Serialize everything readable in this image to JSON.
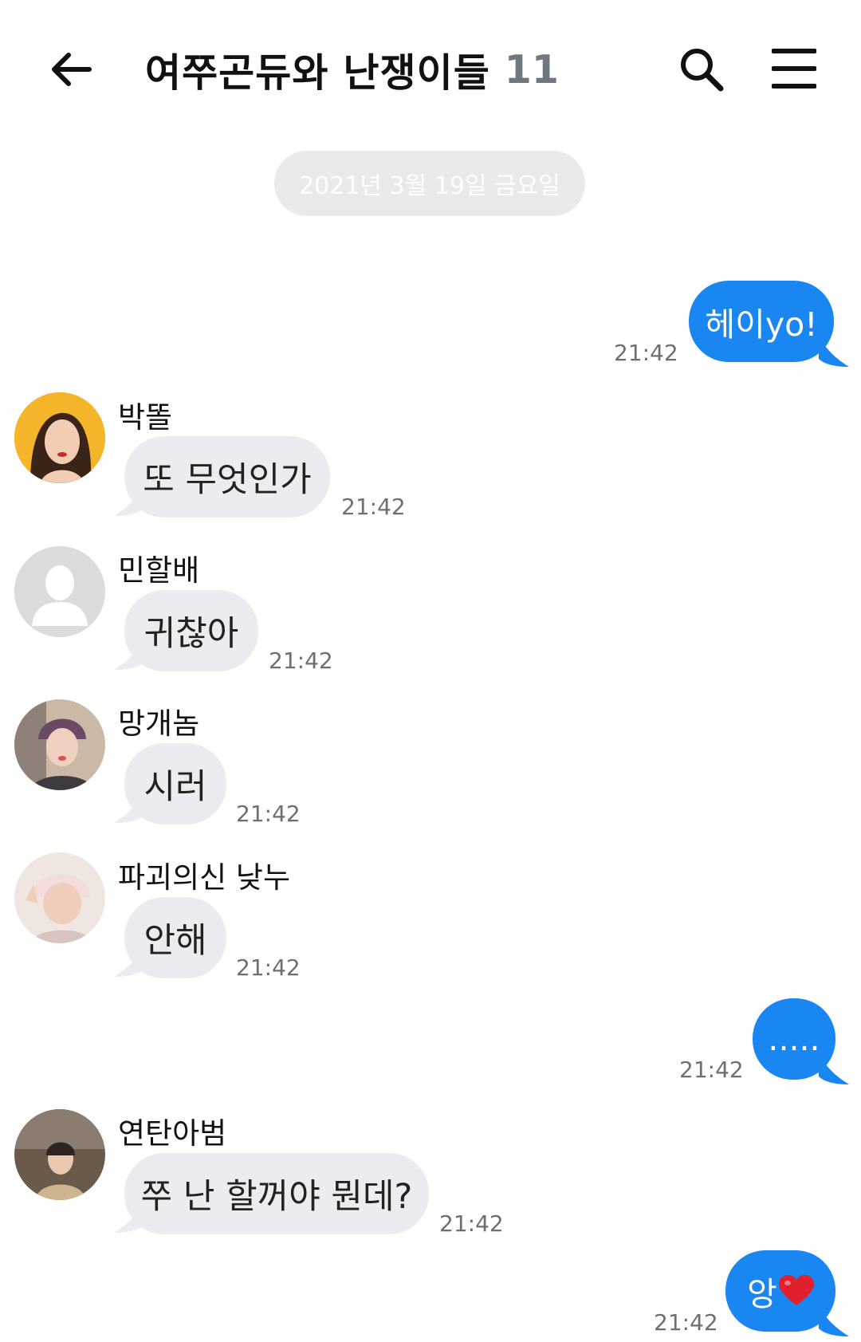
{
  "header": {
    "title": "여쭈곤듀와 난쟁이들",
    "member_count": "11",
    "back_icon": "arrow-left-icon",
    "search_icon": "search-icon",
    "menu_icon": "hamburger-menu-icon"
  },
  "date_divider": "2021년 3월 19일 금요일",
  "colors": {
    "outgoing": "#1a86f2",
    "incoming": "#ececf0"
  },
  "messages": [
    {
      "side": "out",
      "text": "헤이yo!",
      "time": "21:42"
    },
    {
      "side": "in",
      "sender": "박똘",
      "text": "또 무엇인가",
      "time": "21:42"
    },
    {
      "side": "in",
      "sender": "민할배",
      "text": "귀찮아",
      "time": "21:42"
    },
    {
      "side": "in",
      "sender": "망개놈",
      "text": "시러",
      "time": "21:42"
    },
    {
      "side": "in",
      "sender": "파괴의신 낮누",
      "text": "안해",
      "time": "21:42"
    },
    {
      "side": "out",
      "text": ".....",
      "time": "21:42"
    },
    {
      "side": "in",
      "sender": "연탄아범",
      "text": "쭈 난 할꺼야 뭔데?",
      "time": "21:42"
    },
    {
      "side": "out",
      "text": "앙",
      "emoji": "heart-emoji",
      "time": "21:42"
    }
  ]
}
